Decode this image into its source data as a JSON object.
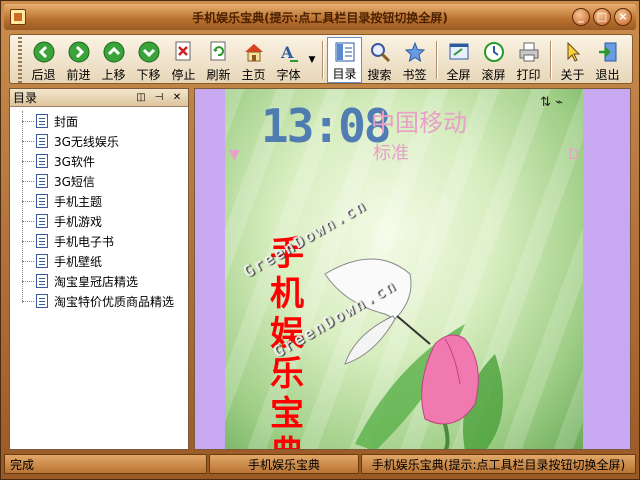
{
  "window": {
    "title": "手机娱乐宝典(提示:点工具栏目录按钮切换全屏)"
  },
  "toolbar": {
    "buttons": [
      {
        "label": "后退",
        "icon": "back-arrow-icon"
      },
      {
        "label": "前进",
        "icon": "forward-arrow-icon"
      },
      {
        "label": "上移",
        "icon": "up-arrow-icon"
      },
      {
        "label": "下移",
        "icon": "down-arrow-icon"
      },
      {
        "label": "停止",
        "icon": "stop-icon"
      },
      {
        "label": "刷新",
        "icon": "refresh-icon"
      },
      {
        "label": "主页",
        "icon": "home-icon"
      },
      {
        "label": "字体",
        "icon": "font-icon"
      },
      {
        "label": "目录",
        "icon": "toc-icon"
      },
      {
        "label": "搜索",
        "icon": "search-icon"
      },
      {
        "label": "书签",
        "icon": "bookmark-star-icon"
      },
      {
        "label": "全屏",
        "icon": "fullscreen-icon"
      },
      {
        "label": "滚屏",
        "icon": "scroll-icon"
      },
      {
        "label": "打印",
        "icon": "print-icon"
      },
      {
        "label": "关于",
        "icon": "about-icon"
      },
      {
        "label": "退出",
        "icon": "exit-icon"
      }
    ],
    "active": "目录"
  },
  "directory": {
    "title": "目录",
    "items": [
      "封面",
      "3G无线娱乐",
      "3G软件",
      "3G短信",
      "手机主题",
      "手机游戏",
      "手机电子书",
      "手机壁纸",
      "淘宝皇冠店精选",
      "淘宝特价优质商品精选"
    ]
  },
  "phone": {
    "time": "13:08",
    "carrier": "中国移动",
    "mode": "标准",
    "status_icons": "⇅ ⌁",
    "vertical_title": "手机娱乐宝典",
    "watermark": "GreenDown.cn"
  },
  "statusbar": {
    "state": "完成",
    "book": "手机娱乐宝典",
    "hint": "手机娱乐宝典(提示:点工具栏目录按钮切换全屏)"
  },
  "colors": {
    "frame": "#b8702e",
    "toolbar_bg": "#f4ead6",
    "accent_red": "#ff0000",
    "phone_side": "#c8a8f0"
  }
}
